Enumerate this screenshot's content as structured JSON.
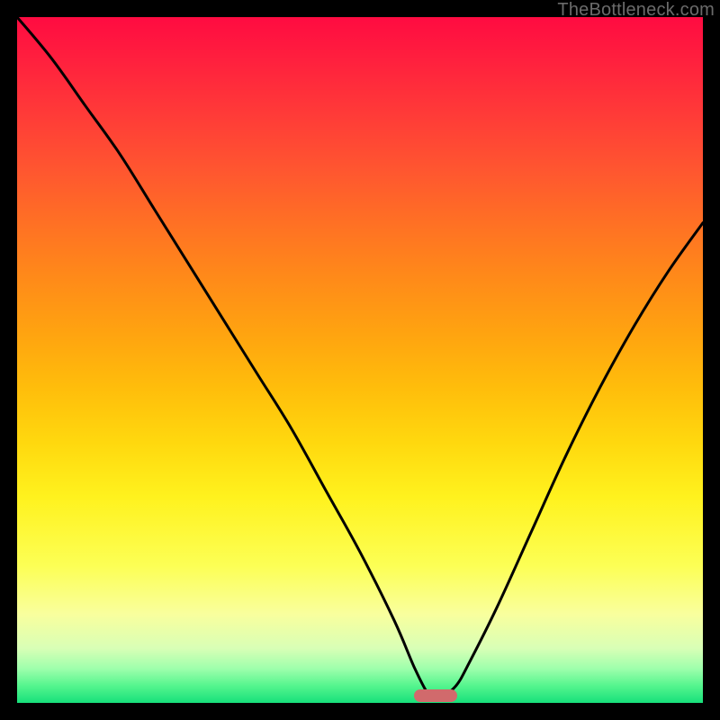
{
  "watermark": {
    "text": "TheBottleneck.com"
  },
  "colors": {
    "frame": "#000000",
    "marker": "#d16a6c",
    "curve": "#000000",
    "gradient_top": "#ff0b41",
    "gradient_bottom": "#17e07b"
  },
  "chart_data": {
    "type": "line",
    "title": "",
    "xlabel": "",
    "ylabel": "",
    "xlim": [
      0,
      100
    ],
    "ylim": [
      0,
      100
    ],
    "grid": false,
    "legend": false,
    "notes": "V-shaped bottleneck curve over vertical red→yellow→green gradient; minimum at the pink marker near x≈61. No axis ticks or numeric labels are visible.",
    "series": [
      {
        "name": "bottleneck-curve",
        "x": [
          0,
          5,
          10,
          15,
          20,
          25,
          30,
          35,
          40,
          45,
          50,
          55,
          58,
          60,
          61,
          62,
          64,
          66,
          70,
          75,
          80,
          85,
          90,
          95,
          100
        ],
        "y": [
          100,
          94,
          87,
          80,
          72,
          64,
          56,
          48,
          40,
          31,
          22,
          12,
          5,
          1.2,
          0.8,
          1.0,
          2.5,
          6,
          14,
          25,
          36,
          46,
          55,
          63,
          70
        ]
      }
    ],
    "marker": {
      "x_center": 61,
      "x_width": 6.3,
      "y": 0.9
    }
  }
}
